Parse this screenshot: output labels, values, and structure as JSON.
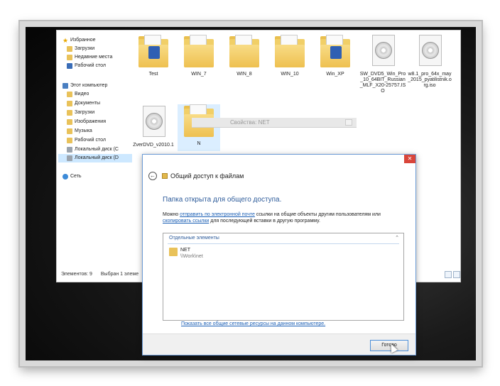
{
  "navigation": {
    "favorites_label": "Избранное",
    "favorites": [
      "Загрузки",
      "Недавние места",
      "Рабочий стол"
    ],
    "computer_label": "Этот компьютер",
    "computer": [
      "Видео",
      "Документы",
      "Загрузки",
      "Изображения",
      "Музыка",
      "Рабочий стол",
      "Локальный диск (C",
      "Локальный диск (D"
    ],
    "network_label": "Сеть"
  },
  "files": [
    {
      "name": "Test",
      "kind": "folder-badge"
    },
    {
      "name": "WIN_7",
      "kind": "folder"
    },
    {
      "name": "WIN_8",
      "kind": "folder"
    },
    {
      "name": "WIN_10",
      "kind": "folder"
    },
    {
      "name": "Win_XP",
      "kind": "folder-badge"
    },
    {
      "name": "SW_DVD5_Win_Pro_10_64BIT_Russian_MLF_X20-25757.ISO",
      "kind": "disc"
    },
    {
      "name": "w8.1_pro_64x_may_2015_pyatilistnik.org.iso",
      "kind": "disc"
    },
    {
      "name": "ZverDVD_v2010.1",
      "kind": "disc"
    },
    {
      "name": "N",
      "kind": "folder"
    }
  ],
  "status": {
    "count": "Элементов: 9",
    "selected": "Выбран 1 элеме"
  },
  "properties_title": "Свойства: NET",
  "dialog": {
    "title": "Общий доступ к файлам",
    "heading": "Папка открыта для общего доступа.",
    "text_before_1": "Можно ",
    "link_email": "отправить по электронной почте",
    "text_mid": " ссылки на общие объекты другим пользователям или",
    "link_copy": "скопировать ссылки",
    "text_after": " для последующей вставки в другую программу.",
    "list_header": "Отдельные элементы",
    "item_name": "NET",
    "item_path": "\\\\Work\\net",
    "show_all_link": "Показать все общие сетевые ресурсы на данном компьютере.",
    "done_button": "Готово",
    "close_glyph": "✕",
    "back_glyph": "←"
  },
  "colors": {
    "accent": "#1b5fb5",
    "heading": "#2d5b9a",
    "close": "#d9453a"
  }
}
